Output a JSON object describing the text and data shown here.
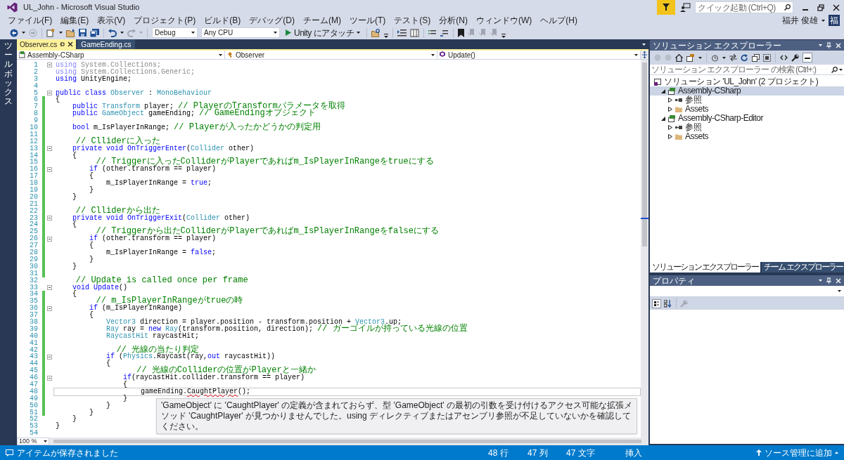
{
  "window": {
    "title": "UL_John - Microsoft Visual Studio"
  },
  "title_bar": {
    "quick_launch_placeholder": "クイック起動 (Ctrl+Q)",
    "user_name": "福井 俊雄",
    "avatar": "福"
  },
  "menu": [
    "ファイル(F)",
    "編集(E)",
    "表示(V)",
    "プロジェクト(P)",
    "ビルド(B)",
    "デバッグ(D)",
    "チーム(M)",
    "ツール(T)",
    "テスト(S)",
    "分析(N)",
    "ウィンドウ(W)",
    "ヘルプ(H)"
  ],
  "toolbar": {
    "configuration": "Debug",
    "platform": "Any CPU",
    "run_label": "Unity にアタッチ"
  },
  "toolbox_label": "ツールボックス",
  "editor": {
    "tabs": [
      {
        "label": "Observer.cs",
        "selected": true
      },
      {
        "label": "GameEnding.cs",
        "selected": false
      }
    ],
    "navigation": [
      {
        "kind": "project",
        "label": "Assembly-CSharp"
      },
      {
        "kind": "class",
        "label": "Observer"
      },
      {
        "kind": "method",
        "label": "Update()"
      }
    ],
    "lines": [
      {
        "number": "1",
        "fold": true,
        "changed": false,
        "current": false,
        "tokens": [
          {
            "kind": "dimkeyword",
            "text": "using"
          },
          {
            "kind": "dim",
            "text": " System.Collections;"
          }
        ]
      },
      {
        "number": "2",
        "fold": false,
        "changed": false,
        "current": false,
        "tokens": [
          {
            "kind": "dimkeyword",
            "text": "using"
          },
          {
            "kind": "dim",
            "text": " System.Collections.Generic;"
          }
        ]
      },
      {
        "number": "3",
        "fold": false,
        "changed": false,
        "current": false,
        "tokens": [
          {
            "kind": "keyword",
            "text": "using"
          },
          {
            "kind": "plain",
            "text": " UnityEngine;"
          }
        ]
      },
      {
        "number": "4",
        "fold": false,
        "changed": false,
        "current": false
      },
      {
        "number": "5",
        "fold": true,
        "changed": false,
        "current": false,
        "tokens": [
          {
            "kind": "keyword",
            "text": "public class "
          },
          {
            "kind": "type",
            "text": "Observer"
          },
          {
            "kind": "plain",
            "text": " : "
          },
          {
            "kind": "type",
            "text": "MonoBehaviour"
          }
        ]
      },
      {
        "number": "6",
        "fold": false,
        "changed": true,
        "current": false,
        "tokens": [
          {
            "kind": "plain",
            "text": "{"
          }
        ]
      },
      {
        "number": "7",
        "fold": false,
        "changed": true,
        "current": false,
        "tokens": [
          {
            "kind": "keyword",
            "text": "    public "
          },
          {
            "kind": "type",
            "text": "Transform"
          },
          {
            "kind": "plain",
            "text": " player; "
          },
          {
            "kind": "comment",
            "text": "// PlayerのTransformパラメータを取得"
          }
        ]
      },
      {
        "number": "8",
        "fold": false,
        "changed": true,
        "current": false,
        "tokens": [
          {
            "kind": "keyword",
            "text": "    public "
          },
          {
            "kind": "type",
            "text": "GameObject"
          },
          {
            "kind": "plain",
            "text": " gameEnding; "
          },
          {
            "kind": "comment",
            "text": "// GameEndingオブジェクト"
          }
        ]
      },
      {
        "number": "9",
        "fold": false,
        "changed": true,
        "current": false
      },
      {
        "number": "10",
        "fold": false,
        "changed": true,
        "current": false,
        "tokens": [
          {
            "kind": "keyword",
            "text": "    bool "
          },
          {
            "kind": "plain",
            "text": "m_IsPlayerInRange; "
          },
          {
            "kind": "comment",
            "text": "// Playerが入ったかどうかの判定用"
          }
        ]
      },
      {
        "number": "11",
        "fold": false,
        "changed": true,
        "current": false
      },
      {
        "number": "12",
        "fold": false,
        "changed": true,
        "current": false,
        "tokens": [
          {
            "kind": "comment",
            "text": "    // Clliderに入った"
          }
        ]
      },
      {
        "number": "13",
        "fold": true,
        "changed": true,
        "current": false,
        "tokens": [
          {
            "kind": "keyword",
            "text": "    private void OnTriggerEnter"
          },
          {
            "kind": "plain",
            "text": "("
          },
          {
            "kind": "type",
            "text": "Collider"
          },
          {
            "kind": "plain",
            "text": " other)"
          }
        ]
      },
      {
        "number": "14",
        "fold": false,
        "changed": true,
        "current": false,
        "tokens": [
          {
            "kind": "plain",
            "text": "    {"
          }
        ]
      },
      {
        "number": "15",
        "fold": false,
        "changed": true,
        "current": false,
        "tokens": [
          {
            "kind": "comment",
            "text": "        // Triggerに入ったColliderがPlayerであればm_IsPlayerInRangeをtrueにする"
          }
        ]
      },
      {
        "number": "16",
        "fold": true,
        "changed": true,
        "current": false,
        "tokens": [
          {
            "kind": "keyword",
            "text": "        if "
          },
          {
            "kind": "plain",
            "text": "(other.transform == player)"
          }
        ]
      },
      {
        "number": "17",
        "fold": false,
        "changed": true,
        "current": false,
        "tokens": [
          {
            "kind": "plain",
            "text": "        {"
          }
        ]
      },
      {
        "number": "18",
        "fold": false,
        "changed": true,
        "current": false,
        "tokens": [
          {
            "kind": "plain",
            "text": "            m_IsPlayerInRange = "
          },
          {
            "kind": "keyword",
            "text": "true"
          },
          {
            "kind": "plain",
            "text": ";"
          }
        ]
      },
      {
        "number": "19",
        "fold": false,
        "changed": true,
        "current": false,
        "tokens": [
          {
            "kind": "plain",
            "text": "        }"
          }
        ]
      },
      {
        "number": "20",
        "fold": false,
        "changed": true,
        "current": false,
        "tokens": [
          {
            "kind": "plain",
            "text": "    }"
          }
        ]
      },
      {
        "number": "21",
        "fold": false,
        "changed": true,
        "current": false
      },
      {
        "number": "22",
        "fold": false,
        "changed": true,
        "current": false,
        "tokens": [
          {
            "kind": "comment",
            "text": "    // Clliderから出た"
          }
        ]
      },
      {
        "number": "23",
        "fold": true,
        "changed": true,
        "current": false,
        "tokens": [
          {
            "kind": "keyword",
            "text": "    private void OnTriggerExit"
          },
          {
            "kind": "plain",
            "text": "("
          },
          {
            "kind": "type",
            "text": "Collider"
          },
          {
            "kind": "plain",
            "text": " other)"
          }
        ]
      },
      {
        "number": "24",
        "fold": false,
        "changed": true,
        "current": false,
        "tokens": [
          {
            "kind": "plain",
            "text": "    {"
          }
        ]
      },
      {
        "number": "25",
        "fold": false,
        "changed": true,
        "current": false,
        "tokens": [
          {
            "kind": "comment",
            "text": "        // Triggerから出たColliderがPlayerであればm_IsPlayerInRangeをfalseにする"
          }
        ]
      },
      {
        "number": "26",
        "fold": true,
        "changed": true,
        "current": false,
        "tokens": [
          {
            "kind": "keyword",
            "text": "        if "
          },
          {
            "kind": "plain",
            "text": "(other.transform == player)"
          }
        ]
      },
      {
        "number": "27",
        "fold": false,
        "changed": true,
        "current": false,
        "tokens": [
          {
            "kind": "plain",
            "text": "        {"
          }
        ]
      },
      {
        "number": "28",
        "fold": false,
        "changed": true,
        "current": false,
        "tokens": [
          {
            "kind": "plain",
            "text": "            m_IsPlayerInRange = "
          },
          {
            "kind": "keyword",
            "text": "false"
          },
          {
            "kind": "plain",
            "text": ";"
          }
        ]
      },
      {
        "number": "29",
        "fold": false,
        "changed": true,
        "current": false,
        "tokens": [
          {
            "kind": "plain",
            "text": "        }"
          }
        ]
      },
      {
        "number": "30",
        "fold": false,
        "changed": true,
        "current": false,
        "tokens": [
          {
            "kind": "plain",
            "text": "    }"
          }
        ]
      },
      {
        "number": "31",
        "fold": false,
        "changed": true,
        "current": false
      },
      {
        "number": "32",
        "fold": false,
        "changed": false,
        "current": false,
        "tokens": [
          {
            "kind": "comment",
            "text": "    // Update is called once per frame"
          }
        ]
      },
      {
        "number": "33",
        "fold": true,
        "changed": false,
        "current": false,
        "tokens": [
          {
            "kind": "keyword",
            "text": "    void Update"
          },
          {
            "kind": "plain",
            "text": "()"
          }
        ]
      },
      {
        "number": "34",
        "fold": false,
        "changed": true,
        "current": false,
        "tokens": [
          {
            "kind": "plain",
            "text": "    {"
          }
        ]
      },
      {
        "number": "35",
        "fold": false,
        "changed": true,
        "current": false,
        "tokens": [
          {
            "kind": "comment",
            "text": "        // m_IsPlayerInRangeがtrueの時"
          }
        ]
      },
      {
        "number": "36",
        "fold": true,
        "changed": true,
        "current": false,
        "tokens": [
          {
            "kind": "keyword",
            "text": "        if "
          },
          {
            "kind": "plain",
            "text": "(m_IsPlayerInRange)"
          }
        ]
      },
      {
        "number": "37",
        "fold": false,
        "changed": true,
        "current": false,
        "tokens": [
          {
            "kind": "plain",
            "text": "        {"
          }
        ]
      },
      {
        "number": "38",
        "fold": false,
        "changed": true,
        "current": false,
        "tokens": [
          {
            "kind": "type",
            "text": "            Vector3"
          },
          {
            "kind": "plain",
            "text": " direction = player.position - transform.position + "
          },
          {
            "kind": "type",
            "text": "Vector3"
          },
          {
            "kind": "plain",
            "text": ".up;"
          }
        ]
      },
      {
        "number": "39",
        "fold": false,
        "changed": true,
        "current": false,
        "tokens": [
          {
            "kind": "type",
            "text": "            Ray"
          },
          {
            "kind": "plain",
            "text": " ray = "
          },
          {
            "kind": "keyword",
            "text": "new "
          },
          {
            "kind": "type",
            "text": "Ray"
          },
          {
            "kind": "plain",
            "text": "(transform.position, direction); "
          },
          {
            "kind": "comment",
            "text": "// ガーゴイルが持っている光線の位置"
          }
        ]
      },
      {
        "number": "40",
        "fold": false,
        "changed": true,
        "current": false,
        "tokens": [
          {
            "kind": "type",
            "text": "            RaycastHit"
          },
          {
            "kind": "plain",
            "text": " raycastHit;"
          }
        ]
      },
      {
        "number": "41",
        "fold": false,
        "changed": true,
        "current": false
      },
      {
        "number": "42",
        "fold": false,
        "changed": true,
        "current": false,
        "tokens": [
          {
            "kind": "comment",
            "text": "            // 光線の当たり判定"
          }
        ]
      },
      {
        "number": "43",
        "fold": true,
        "changed": true,
        "current": false,
        "tokens": [
          {
            "kind": "keyword",
            "text": "            if "
          },
          {
            "kind": "plain",
            "text": "("
          },
          {
            "kind": "type",
            "text": "Physics"
          },
          {
            "kind": "plain",
            "text": ".Raycast(ray,"
          },
          {
            "kind": "keyword",
            "text": "out"
          },
          {
            "kind": "plain",
            "text": " raycastHit))"
          }
        ]
      },
      {
        "number": "44",
        "fold": false,
        "changed": true,
        "current": false,
        "tokens": [
          {
            "kind": "plain",
            "text": "            {"
          }
        ]
      },
      {
        "number": "45",
        "fold": false,
        "changed": true,
        "current": false,
        "tokens": [
          {
            "kind": "comment",
            "text": "                // 光線のColliderの位置がPlayerと一緒か"
          }
        ]
      },
      {
        "number": "46",
        "fold": true,
        "changed": true,
        "current": false,
        "tokens": [
          {
            "kind": "keyword",
            "text": "                if"
          },
          {
            "kind": "plain",
            "text": "(raycastHit.collider.transform == player)"
          }
        ]
      },
      {
        "number": "47",
        "fold": false,
        "changed": true,
        "current": false,
        "tokens": [
          {
            "kind": "plain",
            "text": "                {"
          }
        ]
      },
      {
        "number": "48",
        "fold": false,
        "changed": true,
        "current": true,
        "tokens": [
          {
            "kind": "plain",
            "text": "                    gameEnding."
          },
          {
            "kind": "error",
            "text": "CaughtPlayer"
          },
          {
            "kind": "plain",
            "text": "();"
          }
        ]
      },
      {
        "number": "49",
        "fold": false,
        "changed": true,
        "current": false,
        "tokens": [
          {
            "kind": "plain",
            "text": "                }"
          }
        ]
      },
      {
        "number": "50",
        "fold": false,
        "changed": true,
        "current": false,
        "tokens": [
          {
            "kind": "plain",
            "text": "            }"
          }
        ]
      },
      {
        "number": "51",
        "fold": false,
        "changed": true,
        "current": false,
        "tokens": [
          {
            "kind": "plain",
            "text": "        }"
          }
        ]
      },
      {
        "number": "52",
        "fold": false,
        "changed": false,
        "current": false,
        "tokens": [
          {
            "kind": "plain",
            "text": "    }"
          }
        ]
      },
      {
        "number": "53",
        "fold": false,
        "changed": false,
        "current": false,
        "tokens": [
          {
            "kind": "plain",
            "text": "}"
          }
        ]
      },
      {
        "number": "54",
        "fold": false,
        "changed": false,
        "current": false
      }
    ],
    "tooltip": "'GameObject' に 'CaughtPlayer' の定義が含まれておらず、型 'GameObject' の最初の引数を受け付けるアクセス可能な拡張メソッド 'CaughtPlayer' が見つかりませんでした。using ディレクティブまたはアセンブリ参照が不足していないかを確認してください。",
    "zoom": "100 %"
  },
  "solution_explorer": {
    "title": "ソリューション エクスプローラー",
    "search_placeholder": "ソリューション エクスプローラー の検索 (Ctrl+:)",
    "tree": [
      {
        "kind": "solution",
        "label": "ソリューション 'UL_John' (2 プロジェクト)",
        "selected": false,
        "children": [
          {
            "kind": "project",
            "label": "Assembly-CSharp",
            "expanded": true,
            "selected": true,
            "children": [
              {
                "kind": "references",
                "label": "参照",
                "expanded": false,
                "selected": false
              },
              {
                "kind": "folder",
                "label": "Assets",
                "expanded": false,
                "selected": false
              }
            ]
          },
          {
            "kind": "project",
            "label": "Assembly-CSharp-Editor",
            "expanded": true,
            "selected": false,
            "children": [
              {
                "kind": "references",
                "label": "参照",
                "expanded": false,
                "selected": false
              },
              {
                "kind": "folder",
                "label": "Assets",
                "expanded": false,
                "selected": false
              }
            ]
          }
        ]
      }
    ],
    "tabs": [
      {
        "label": "ソリューション エクスプローラー",
        "selected": true
      },
      {
        "label": "チーム エクスプローラー",
        "selected": false
      }
    ]
  },
  "properties": {
    "title": "プロパティ"
  },
  "status_bar": {
    "message": "アイテムが保存されました",
    "line": "48 行",
    "column": "47 列",
    "character": "47 文字",
    "mode": "挿入",
    "source_control": "ソース管理に追加"
  }
}
